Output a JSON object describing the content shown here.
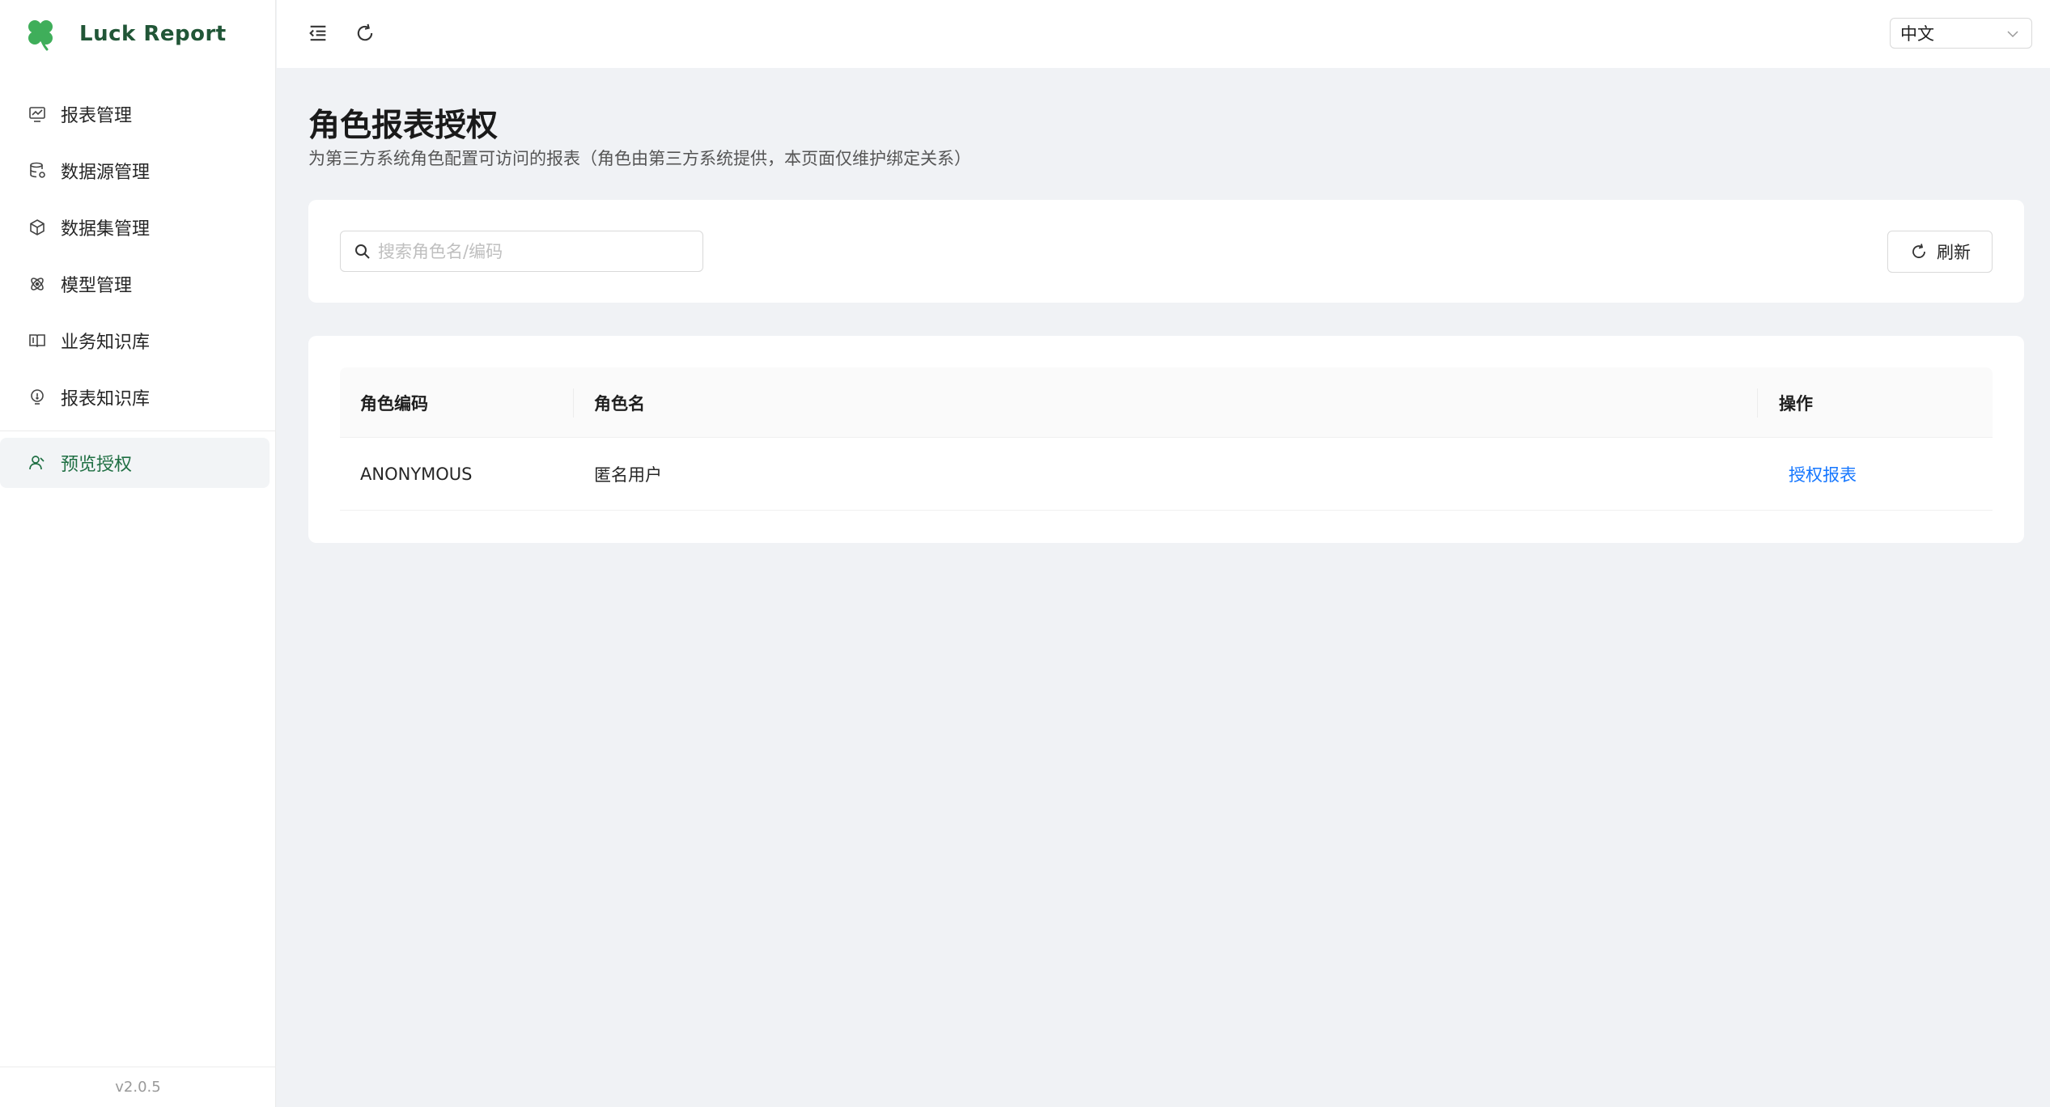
{
  "app": {
    "brand_name": "Luck Report",
    "version": "v2.0.5",
    "accent_color": "#1f6f43",
    "logo_color": "#3fae5a"
  },
  "sidebar": {
    "items": [
      {
        "label": "报表管理",
        "icon": "chart-board-icon"
      },
      {
        "label": "数据源管理",
        "icon": "database-icon"
      },
      {
        "label": "数据集管理",
        "icon": "cube-icon"
      },
      {
        "label": "模型管理",
        "icon": "atom-icon"
      },
      {
        "label": "业务知识库",
        "icon": "book-icon"
      },
      {
        "label": "报表知识库",
        "icon": "lightbulb-icon"
      }
    ],
    "active_item": {
      "label": "预览授权",
      "icon": "user-icon"
    }
  },
  "topbar": {
    "language": "中文"
  },
  "page": {
    "title": "角色报表授权",
    "subtitle": "为第三方系统角色配置可访问的报表（角色由第三方系统提供，本页面仅维护绑定关系）"
  },
  "search": {
    "placeholder": "搜索角色名/编码",
    "value": "",
    "refresh_label": "刷新"
  },
  "table": {
    "columns": [
      "角色编码",
      "角色名",
      "操作"
    ],
    "rows": [
      {
        "code": "ANONYMOUS",
        "name": "匿名用户",
        "action": "授权报表"
      }
    ]
  }
}
